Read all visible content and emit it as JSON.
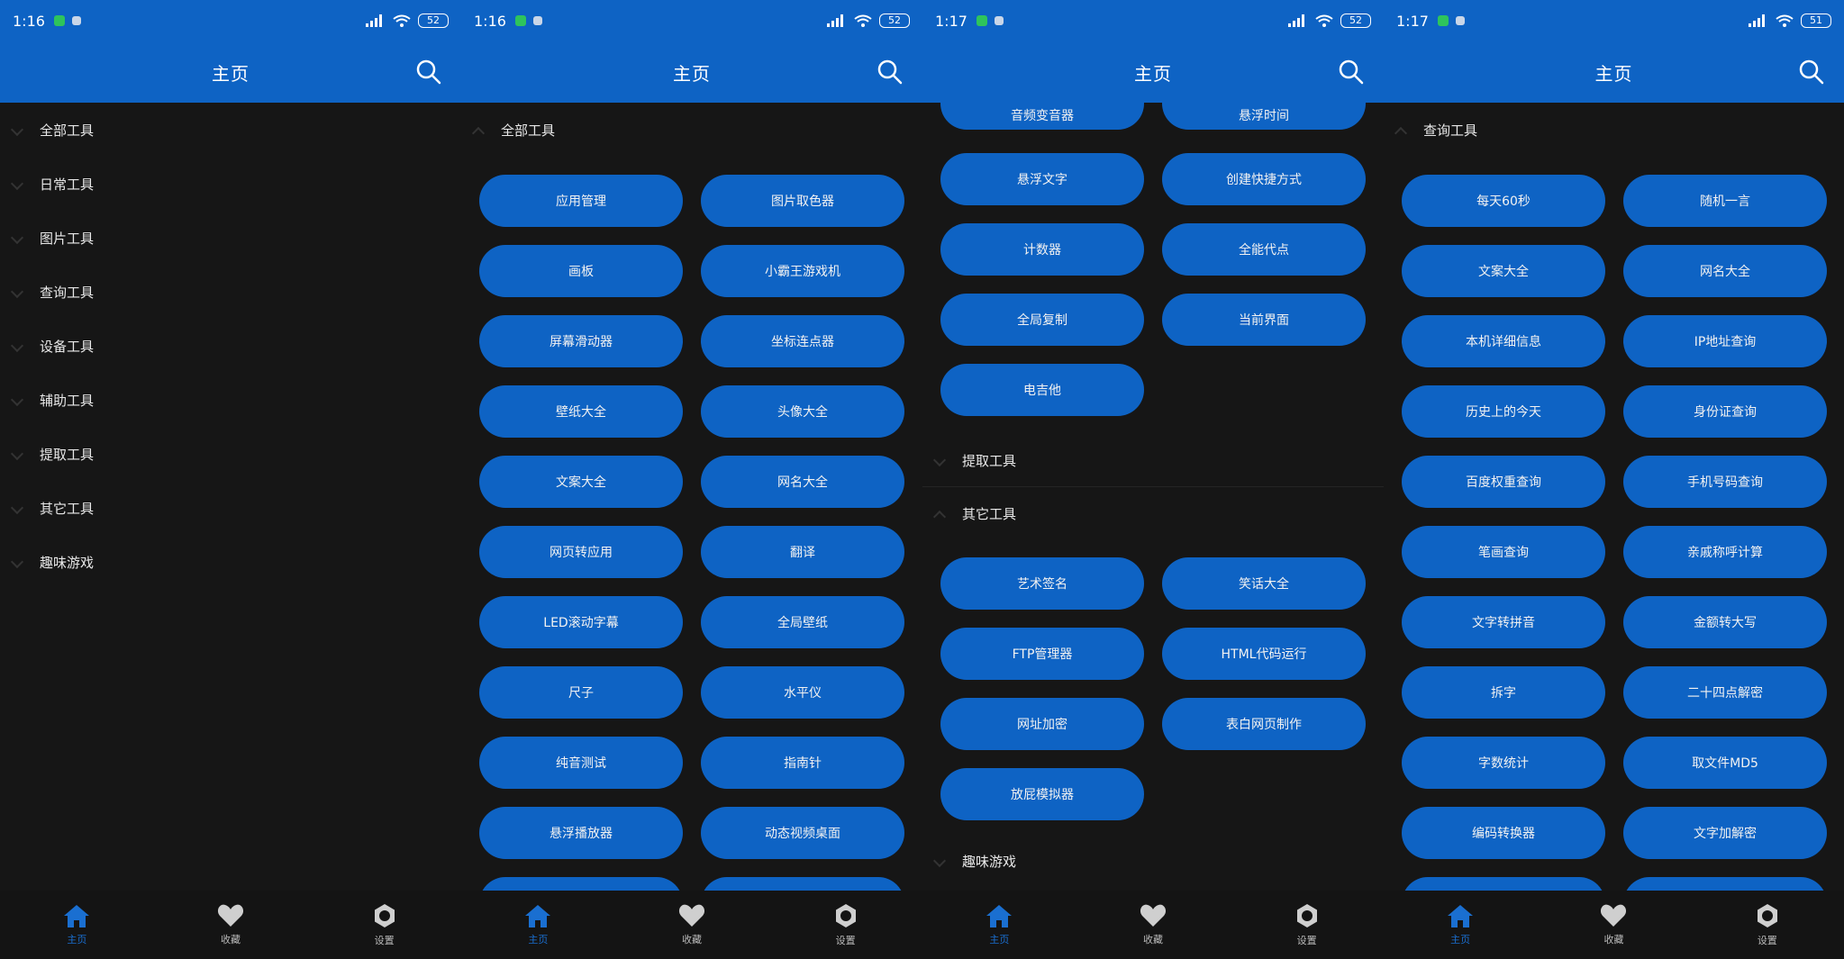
{
  "screens": [
    {
      "status": {
        "time": "1:16",
        "battery": "52"
      },
      "title": "主页",
      "categories": [
        "全部工具",
        "日常工具",
        "图片工具",
        "查询工具",
        "设备工具",
        "辅助工具",
        "提取工具",
        "其它工具",
        "趣味游戏"
      ]
    },
    {
      "status": {
        "time": "1:16",
        "battery": "52"
      },
      "title": "主页",
      "section": "全部工具",
      "buttons": [
        "应用管理",
        "图片取色器",
        "画板",
        "小霸王游戏机",
        "屏幕滑动器",
        "坐标连点器",
        "壁纸大全",
        "头像大全",
        "文案大全",
        "网名大全",
        "网页转应用",
        "翻译",
        "LED滚动字幕",
        "全局壁纸",
        "尺子",
        "水平仪",
        "纯音测试",
        "指南针",
        "悬浮播放器",
        "动态视频桌面"
      ]
    },
    {
      "status": {
        "time": "1:17",
        "battery": "52"
      },
      "title": "主页",
      "partial_top": [
        "音频变音器",
        "悬浮时间"
      ],
      "buttons_a": [
        "悬浮文字",
        "创建快捷方式",
        "计数器",
        "全能代点",
        "全局复制",
        "当前界面",
        "电吉他"
      ],
      "section_b": "提取工具",
      "section_c": "其它工具",
      "buttons_c": [
        "艺术签名",
        "笑话大全",
        "FTP管理器",
        "HTML代码运行",
        "网址加密",
        "表白网页制作",
        "放屁模拟器"
      ],
      "section_d": "趣味游戏"
    },
    {
      "status": {
        "time": "1:17",
        "battery": "51"
      },
      "title": "主页",
      "section": "查询工具",
      "buttons": [
        "每天60秒",
        "随机一言",
        "文案大全",
        "网名大全",
        "本机详细信息",
        "IP地址查询",
        "历史上的今天",
        "身份证查询",
        "百度权重查询",
        "手机号码查询",
        "笔画查询",
        "亲戚称呼计算",
        "文字转拼音",
        "金额转大写",
        "拆字",
        "二十四点解密",
        "字数统计",
        "取文件MD5",
        "编码转换器",
        "文字加解密"
      ]
    }
  ],
  "nav": {
    "home": "主页",
    "favorites": "收藏",
    "settings": "设置"
  },
  "colors": {
    "accent": "#0e63c4",
    "background": "#161616"
  }
}
